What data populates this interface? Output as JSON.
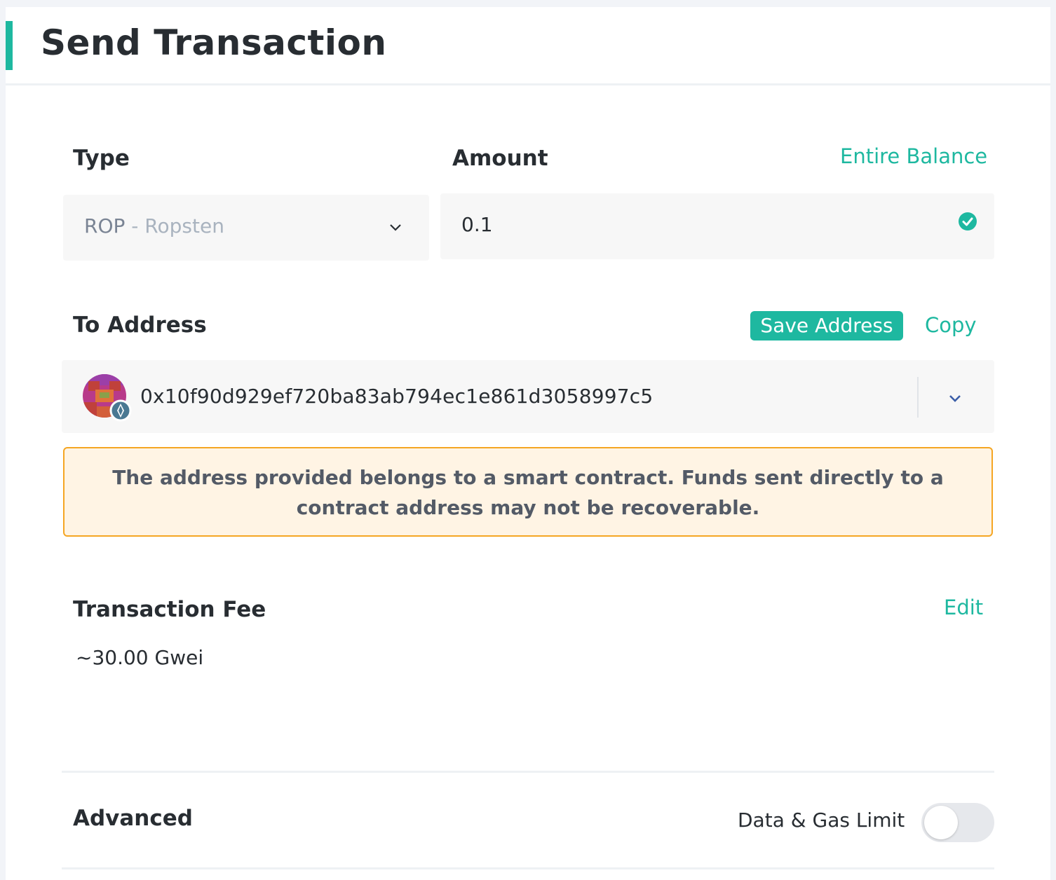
{
  "page": {
    "title": "Send Transaction"
  },
  "type": {
    "label": "Type",
    "code": "ROP",
    "name": "Ropsten"
  },
  "amount": {
    "label": "Amount",
    "entire_balance": "Entire Balance",
    "value": "0.1"
  },
  "to_address": {
    "label": "To Address",
    "save_label": "Save Address",
    "copy_label": "Copy",
    "value": "0x10f90d929ef720ba83ab794ec1e861d3058997c5"
  },
  "warning": {
    "text": "The address provided belongs to a smart contract. Funds sent directly to a contract address may not be recoverable."
  },
  "fee": {
    "label": "Transaction Fee",
    "edit_label": "Edit",
    "value": "~30.00 Gwei"
  },
  "advanced": {
    "label": "Advanced",
    "toggle_label": "Data & Gas Limit",
    "toggle_on": false
  },
  "colors": {
    "accent": "#1eb8a0",
    "warning_border": "#f5a623",
    "warning_bg": "#fff4e4"
  },
  "icons": [
    "chevron-down-icon",
    "check-circle-icon",
    "identicon-avatar",
    "ethereum-icon"
  ]
}
